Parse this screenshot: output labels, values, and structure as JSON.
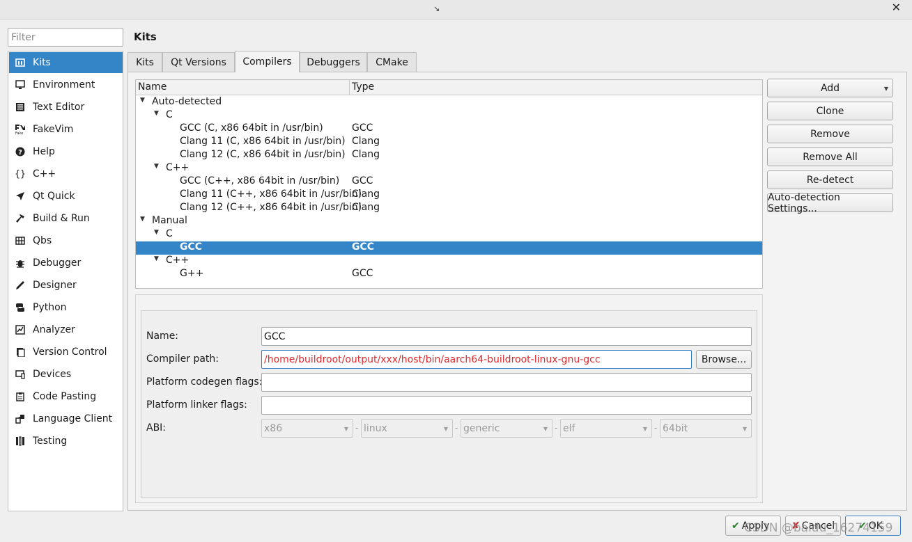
{
  "titlebar": {
    "close_glyph": "✕"
  },
  "filter": {
    "placeholder": "Filter"
  },
  "sidebar": {
    "items": [
      {
        "label": "Kits",
        "icon": "kits-icon"
      },
      {
        "label": "Environment",
        "icon": "monitor-icon"
      },
      {
        "label": "Text Editor",
        "icon": "text-editor-icon"
      },
      {
        "label": "FakeVim",
        "icon": "fakevim-icon"
      },
      {
        "label": "Help",
        "icon": "help-icon"
      },
      {
        "label": "C++",
        "icon": "braces-icon"
      },
      {
        "label": "Qt Quick",
        "icon": "qt-quick-icon"
      },
      {
        "label": "Build & Run",
        "icon": "hammer-icon"
      },
      {
        "label": "Qbs",
        "icon": "qbs-icon"
      },
      {
        "label": "Debugger",
        "icon": "bug-icon"
      },
      {
        "label": "Designer",
        "icon": "pen-icon"
      },
      {
        "label": "Python",
        "icon": "python-icon"
      },
      {
        "label": "Analyzer",
        "icon": "analyzer-icon"
      },
      {
        "label": "Version Control",
        "icon": "version-control-icon"
      },
      {
        "label": "Devices",
        "icon": "devices-icon"
      },
      {
        "label": "Code Pasting",
        "icon": "clipboard-icon"
      },
      {
        "label": "Language Client",
        "icon": "language-client-icon"
      },
      {
        "label": "Testing",
        "icon": "testing-icon"
      }
    ]
  },
  "page": {
    "title": "Kits"
  },
  "tabs": [
    {
      "label": "Kits"
    },
    {
      "label": "Qt Versions"
    },
    {
      "label": "Compilers"
    },
    {
      "label": "Debuggers"
    },
    {
      "label": "CMake"
    }
  ],
  "tree": {
    "headers": {
      "name": "Name",
      "type": "Type"
    },
    "rows": [
      {
        "name": "Auto-detected",
        "type": "",
        "expander": "▼"
      },
      {
        "name": "C",
        "type": "",
        "expander": "▼"
      },
      {
        "name": "GCC (C, x86 64bit in /usr/bin)",
        "type": "GCC"
      },
      {
        "name": "Clang 11 (C, x86 64bit in /usr/bin)",
        "type": "Clang"
      },
      {
        "name": "Clang 12 (C, x86 64bit in /usr/bin)",
        "type": "Clang"
      },
      {
        "name": "C++",
        "type": "",
        "expander": "▼"
      },
      {
        "name": "GCC (C++, x86 64bit in /usr/bin)",
        "type": "GCC"
      },
      {
        "name": "Clang 11 (C++, x86 64bit in /usr/bin)",
        "type": "Clang"
      },
      {
        "name": "Clang 12 (C++, x86 64bit in /usr/bin)",
        "type": "Clang"
      },
      {
        "name": "Manual",
        "type": "",
        "expander": "▼"
      },
      {
        "name": "C",
        "type": "",
        "expander": "▼"
      },
      {
        "name": "GCC",
        "type": "GCC"
      },
      {
        "name": "C++",
        "type": "",
        "expander": "▼"
      },
      {
        "name": "G++",
        "type": "GCC"
      }
    ]
  },
  "buttons": {
    "add": "Add",
    "add_arrow": "▼",
    "clone": "Clone",
    "remove": "Remove",
    "remove_all": "Remove All",
    "redetect": "Re-detect",
    "autodetect_settings": "Auto-detection Settings..."
  },
  "form": {
    "name_label": "Name:",
    "name_value": "GCC",
    "compiler_path_label": "Compiler path:",
    "compiler_path_value": "/home/buildroot/output/xxx/host/bin/aarch64-buildroot-linux-gnu-gcc",
    "browse_label": "Browse...",
    "codegen_label": "Platform codegen flags:",
    "codegen_value": "",
    "linker_label": "Platform linker flags:",
    "linker_value": "",
    "abi_label": "ABI:",
    "abi": [
      "x86",
      "linux",
      "generic",
      "elf",
      "64bit"
    ],
    "abi_separator": "-",
    "combo_arrow": "▼"
  },
  "footer": {
    "apply": "Apply",
    "apply_icon": "✔",
    "cancel": "Cancel",
    "cancel_icon": "✘",
    "ok": "OK",
    "ok_icon": "✔",
    "watermark": "CSDN @baidu_16274159"
  },
  "colors": {
    "selection": "#3484c8",
    "path_text": "#e0282d",
    "focus_border": "#3a7fc4"
  }
}
